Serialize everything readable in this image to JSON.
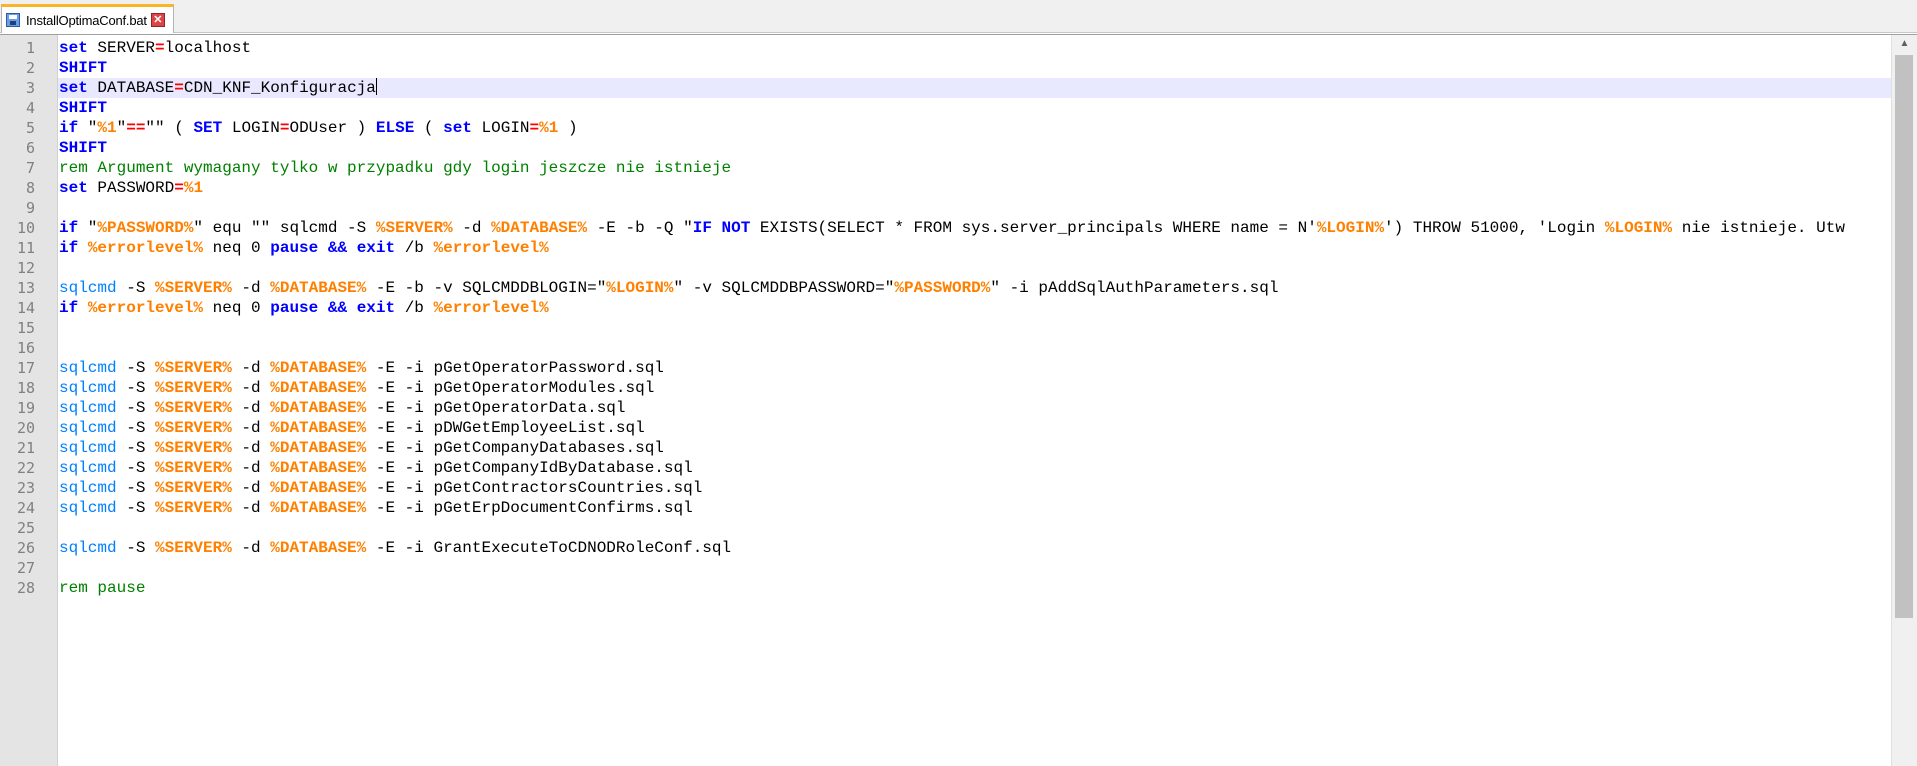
{
  "tab": {
    "filename": "InstallOptimaConf.bat",
    "save_icon": "save-icon",
    "close_icon": "close-icon",
    "close_glyph": "✕"
  },
  "editor": {
    "current_line": 3,
    "scroll_up_glyph": "▲",
    "lines": [
      [
        [
          "kw",
          "set"
        ],
        [
          "t",
          " SERVER"
        ],
        [
          "op",
          "="
        ],
        [
          "t",
          "localhost"
        ]
      ],
      [
        [
          "kw",
          "SHIFT"
        ]
      ],
      [
        [
          "kw",
          "set"
        ],
        [
          "t",
          " DATABASE"
        ],
        [
          "op",
          "="
        ],
        [
          "t",
          "CDN_KNF_Konfiguracja"
        ]
      ],
      [
        [
          "kw",
          "SHIFT"
        ]
      ],
      [
        [
          "kw",
          "if"
        ],
        [
          "t",
          " \""
        ],
        [
          "var",
          "%1"
        ],
        [
          "t",
          "\""
        ],
        [
          "op",
          "=="
        ],
        [
          "t",
          "\"\" ( "
        ],
        [
          "kw",
          "SET"
        ],
        [
          "t",
          " LOGIN"
        ],
        [
          "op",
          "="
        ],
        [
          "t",
          "ODUser ) "
        ],
        [
          "kw",
          "ELSE"
        ],
        [
          "t",
          " ( "
        ],
        [
          "kw",
          "set"
        ],
        [
          "t",
          " LOGIN"
        ],
        [
          "op",
          "="
        ],
        [
          "var",
          "%1"
        ],
        [
          "t",
          " )"
        ]
      ],
      [
        [
          "kw",
          "SHIFT"
        ]
      ],
      [
        [
          "rem",
          "rem Argument wymagany tylko w przypadku gdy login jeszcze nie istnieje"
        ]
      ],
      [
        [
          "kw",
          "set"
        ],
        [
          "t",
          " PASSWORD"
        ],
        [
          "op",
          "="
        ],
        [
          "var",
          "%1"
        ]
      ],
      [],
      [
        [
          "kw",
          "if"
        ],
        [
          "t",
          " \""
        ],
        [
          "var",
          "%PASSWORD%"
        ],
        [
          "t",
          "\" equ \"\" sqlcmd -S "
        ],
        [
          "var",
          "%SERVER%"
        ],
        [
          "t",
          " -d "
        ],
        [
          "var",
          "%DATABASE%"
        ],
        [
          "t",
          " -E -b -Q \""
        ],
        [
          "kw",
          "IF NOT"
        ],
        [
          "t",
          " EXISTS(SELECT * FROM sys.server_principals WHERE name = N'"
        ],
        [
          "var",
          "%LOGIN%"
        ],
        [
          "t",
          "') THROW 51000, 'Login "
        ],
        [
          "var",
          "%LOGIN%"
        ],
        [
          "t",
          " nie istnieje. Utw"
        ]
      ],
      [
        [
          "kw",
          "if"
        ],
        [
          "t",
          " "
        ],
        [
          "var",
          "%errorlevel%"
        ],
        [
          "t",
          " neq 0 "
        ],
        [
          "kw",
          "pause"
        ],
        [
          "t",
          " "
        ],
        [
          "kw",
          "&&"
        ],
        [
          "t",
          " "
        ],
        [
          "kw",
          "exit"
        ],
        [
          "t",
          " /b "
        ],
        [
          "var",
          "%errorlevel%"
        ]
      ],
      [],
      [
        [
          "cmd",
          "sqlcmd"
        ],
        [
          "t",
          " -S "
        ],
        [
          "var",
          "%SERVER%"
        ],
        [
          "t",
          " -d "
        ],
        [
          "var",
          "%DATABASE%"
        ],
        [
          "t",
          " -E -b -v SQLCMDDBLOGIN=\""
        ],
        [
          "var",
          "%LOGIN%"
        ],
        [
          "t",
          "\" -v SQLCMDDBPASSWORD=\""
        ],
        [
          "var",
          "%PASSWORD%"
        ],
        [
          "t",
          "\" -i pAddSqlAuthParameters.sql"
        ]
      ],
      [
        [
          "kw",
          "if"
        ],
        [
          "t",
          " "
        ],
        [
          "var",
          "%errorlevel%"
        ],
        [
          "t",
          " neq 0 "
        ],
        [
          "kw",
          "pause"
        ],
        [
          "t",
          " "
        ],
        [
          "kw",
          "&&"
        ],
        [
          "t",
          " "
        ],
        [
          "kw",
          "exit"
        ],
        [
          "t",
          " /b "
        ],
        [
          "var",
          "%errorlevel%"
        ]
      ],
      [],
      [],
      [
        [
          "cmd",
          "sqlcmd"
        ],
        [
          "t",
          " -S "
        ],
        [
          "var",
          "%SERVER%"
        ],
        [
          "t",
          " -d "
        ],
        [
          "var",
          "%DATABASE%"
        ],
        [
          "t",
          " -E -i pGetOperatorPassword.sql"
        ]
      ],
      [
        [
          "cmd",
          "sqlcmd"
        ],
        [
          "t",
          " -S "
        ],
        [
          "var",
          "%SERVER%"
        ],
        [
          "t",
          " -d "
        ],
        [
          "var",
          "%DATABASE%"
        ],
        [
          "t",
          " -E -i pGetOperatorModules.sql"
        ]
      ],
      [
        [
          "cmd",
          "sqlcmd"
        ],
        [
          "t",
          " -S "
        ],
        [
          "var",
          "%SERVER%"
        ],
        [
          "t",
          " -d "
        ],
        [
          "var",
          "%DATABASE%"
        ],
        [
          "t",
          " -E -i pGetOperatorData.sql"
        ]
      ],
      [
        [
          "cmd",
          "sqlcmd"
        ],
        [
          "t",
          " -S "
        ],
        [
          "var",
          "%SERVER%"
        ],
        [
          "t",
          " -d "
        ],
        [
          "var",
          "%DATABASE%"
        ],
        [
          "t",
          " -E -i pDWGetEmployeeList.sql"
        ]
      ],
      [
        [
          "cmd",
          "sqlcmd"
        ],
        [
          "t",
          " -S "
        ],
        [
          "var",
          "%SERVER%"
        ],
        [
          "t",
          " -d "
        ],
        [
          "var",
          "%DATABASE%"
        ],
        [
          "t",
          " -E -i pGetCompanyDatabases.sql"
        ]
      ],
      [
        [
          "cmd",
          "sqlcmd"
        ],
        [
          "t",
          " -S "
        ],
        [
          "var",
          "%SERVER%"
        ],
        [
          "t",
          " -d "
        ],
        [
          "var",
          "%DATABASE%"
        ],
        [
          "t",
          " -E -i pGetCompanyIdByDatabase.sql"
        ]
      ],
      [
        [
          "cmd",
          "sqlcmd"
        ],
        [
          "t",
          " -S "
        ],
        [
          "var",
          "%SERVER%"
        ],
        [
          "t",
          " -d "
        ],
        [
          "var",
          "%DATABASE%"
        ],
        [
          "t",
          " -E -i pGetContractorsCountries.sql"
        ]
      ],
      [
        [
          "cmd",
          "sqlcmd"
        ],
        [
          "t",
          " -S "
        ],
        [
          "var",
          "%SERVER%"
        ],
        [
          "t",
          " -d "
        ],
        [
          "var",
          "%DATABASE%"
        ],
        [
          "t",
          " -E -i pGetErpDocumentConfirms.sql"
        ]
      ],
      [],
      [
        [
          "cmd",
          "sqlcmd"
        ],
        [
          "t",
          " -S "
        ],
        [
          "var",
          "%SERVER%"
        ],
        [
          "t",
          " -d "
        ],
        [
          "var",
          "%DATABASE%"
        ],
        [
          "t",
          " -E -i GrantExecuteToCDNODRoleConf.sql"
        ]
      ],
      [],
      [
        [
          "rem",
          "rem pause"
        ]
      ]
    ]
  }
}
